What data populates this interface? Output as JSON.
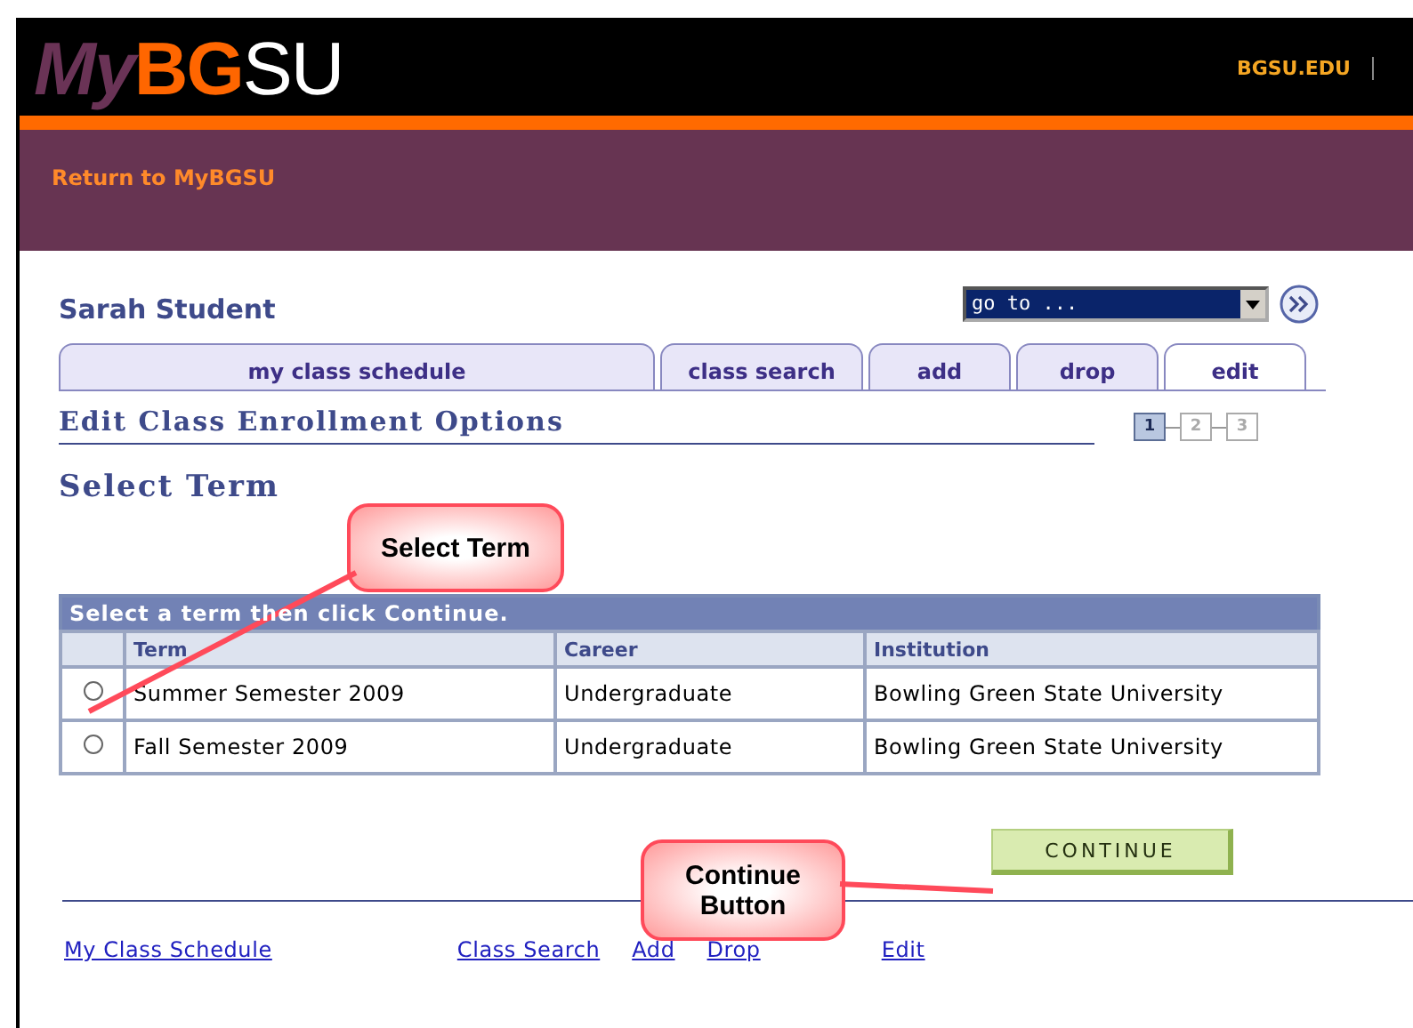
{
  "header": {
    "logo": [
      "My",
      "BG",
      "SU"
    ],
    "site_link": "BGSU.EDU"
  },
  "nav": {
    "return_link": "Return to MyBGSU"
  },
  "student_name": "Sarah Student",
  "goto": {
    "value": "go to ..."
  },
  "tabs": [
    {
      "label": "my class schedule",
      "selected": false
    },
    {
      "label": "class search",
      "selected": false
    },
    {
      "label": "add",
      "selected": false
    },
    {
      "label": "drop",
      "selected": false
    },
    {
      "label": "edit",
      "selected": true
    }
  ],
  "page_title": "Edit Class Enrollment Options",
  "steps": [
    {
      "label": "1",
      "selected": true
    },
    {
      "label": "2",
      "selected": false
    },
    {
      "label": "3",
      "selected": false
    }
  ],
  "section_title": "Select Term",
  "table": {
    "caption": "Select a term then click Continue.",
    "columns": [
      "Term",
      "Career",
      "Institution"
    ],
    "rows": [
      {
        "checked": false,
        "cells": [
          "Summer Semester 2009",
          "Undergraduate",
          "Bowling Green State University"
        ]
      },
      {
        "checked": false,
        "cells": [
          "Fall Semester 2009",
          "Undergraduate",
          "Bowling Green State University"
        ]
      }
    ]
  },
  "continue_button": "CONTINUE",
  "callouts": [
    "Select Term",
    "Continue\nButton"
  ],
  "footer_links": [
    "My Class Schedule",
    "Class Search",
    "Add",
    "Drop",
    "Edit"
  ]
}
